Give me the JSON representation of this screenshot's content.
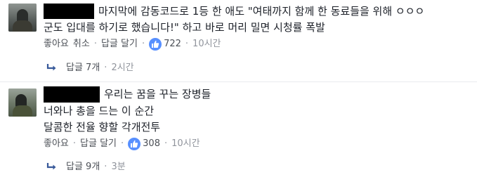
{
  "comments": [
    {
      "lines": [
        "마지막에 감동코드로 1등 한 애도 \"여태까지 함께 한 동료들을 위해 ㅇㅇㅇ",
        "군도 입대를 하기로 했습니다!\" 하고 바로 머리 밀면 시청률 폭발"
      ],
      "actions": {
        "like": "좋아요",
        "cancel": "취소",
        "reply": "답글 달기",
        "like_count": "722",
        "time": "10시간"
      },
      "replies": {
        "label": "답글 7개",
        "time": "2시간"
      }
    },
    {
      "lines": [
        "우리는 꿈을 꾸는 장병들",
        "너와나 총을 드는 이 순간",
        "달콤한 전율 향할 각개전투"
      ],
      "actions": {
        "like": "좋아요",
        "reply": "답글 달기",
        "like_count": "308",
        "time": "10시간"
      },
      "replies": {
        "label": "답글 9개",
        "time": "3분"
      }
    }
  ],
  "colors": {
    "text": "#1d2129",
    "action": "#4b4f56",
    "meta": "#90949c",
    "like_blue": "#5890ff",
    "reply_blue": "#365899",
    "redaction": "#000000"
  },
  "icons": {
    "like": "thumbs-up-icon",
    "reply_arrow": "reply-arrow-icon"
  }
}
